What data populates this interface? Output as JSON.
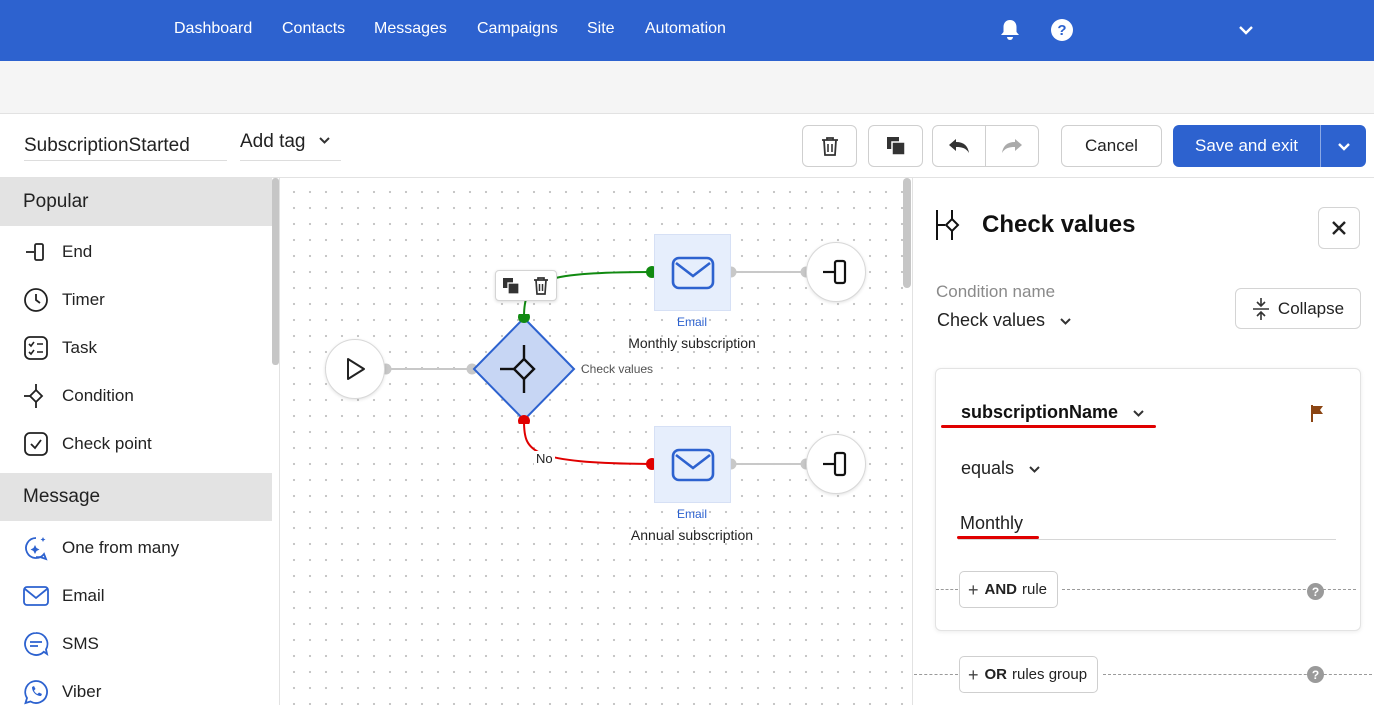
{
  "nav": {
    "items": [
      "Dashboard",
      "Contacts",
      "Messages",
      "Campaigns",
      "Site",
      "Automation"
    ],
    "icons": [
      "bell-icon",
      "help-icon",
      "chevron-down-icon"
    ]
  },
  "toolbar": {
    "flow_name": "SubscriptionStarted",
    "add_tag_label": "Add tag",
    "cancel_label": "Cancel",
    "save_label": "Save and exit"
  },
  "sidebar": {
    "sections": [
      {
        "title": "Popular",
        "items": [
          {
            "label": "End",
            "icon": "end-icon"
          },
          {
            "label": "Timer",
            "icon": "timer-icon"
          },
          {
            "label": "Task",
            "icon": "task-icon"
          },
          {
            "label": "Condition",
            "icon": "condition-icon"
          },
          {
            "label": "Check point",
            "icon": "check-point-icon"
          }
        ]
      },
      {
        "title": "Message",
        "items": [
          {
            "label": "One from many",
            "icon": "sparkle-chat-icon"
          },
          {
            "label": "Email",
            "icon": "envelope-icon"
          },
          {
            "label": "SMS",
            "icon": "sms-icon"
          },
          {
            "label": "Viber",
            "icon": "viber-icon"
          }
        ]
      }
    ]
  },
  "canvas": {
    "condition_edge_label": "Check values",
    "no_label": "No",
    "nodes": [
      {
        "type": "Email",
        "label": "Monthly subscription"
      },
      {
        "type": "Email",
        "label": "Annual subscription"
      }
    ],
    "colors": {
      "yes_edge": "#118a11",
      "no_edge": "#e00000",
      "accent": "#2d62cf"
    }
  },
  "panel": {
    "title": "Check values",
    "condition_name_label": "Condition name",
    "condition_name_value": "Check values",
    "collapse_label": "Collapse",
    "rule": {
      "field": "subscriptionName",
      "operator": "equals",
      "value": "Monthly"
    },
    "and_keyword": "AND",
    "and_suffix": "rule",
    "or_keyword": "OR",
    "or_suffix": "rules group",
    "help_glyph": "?"
  }
}
